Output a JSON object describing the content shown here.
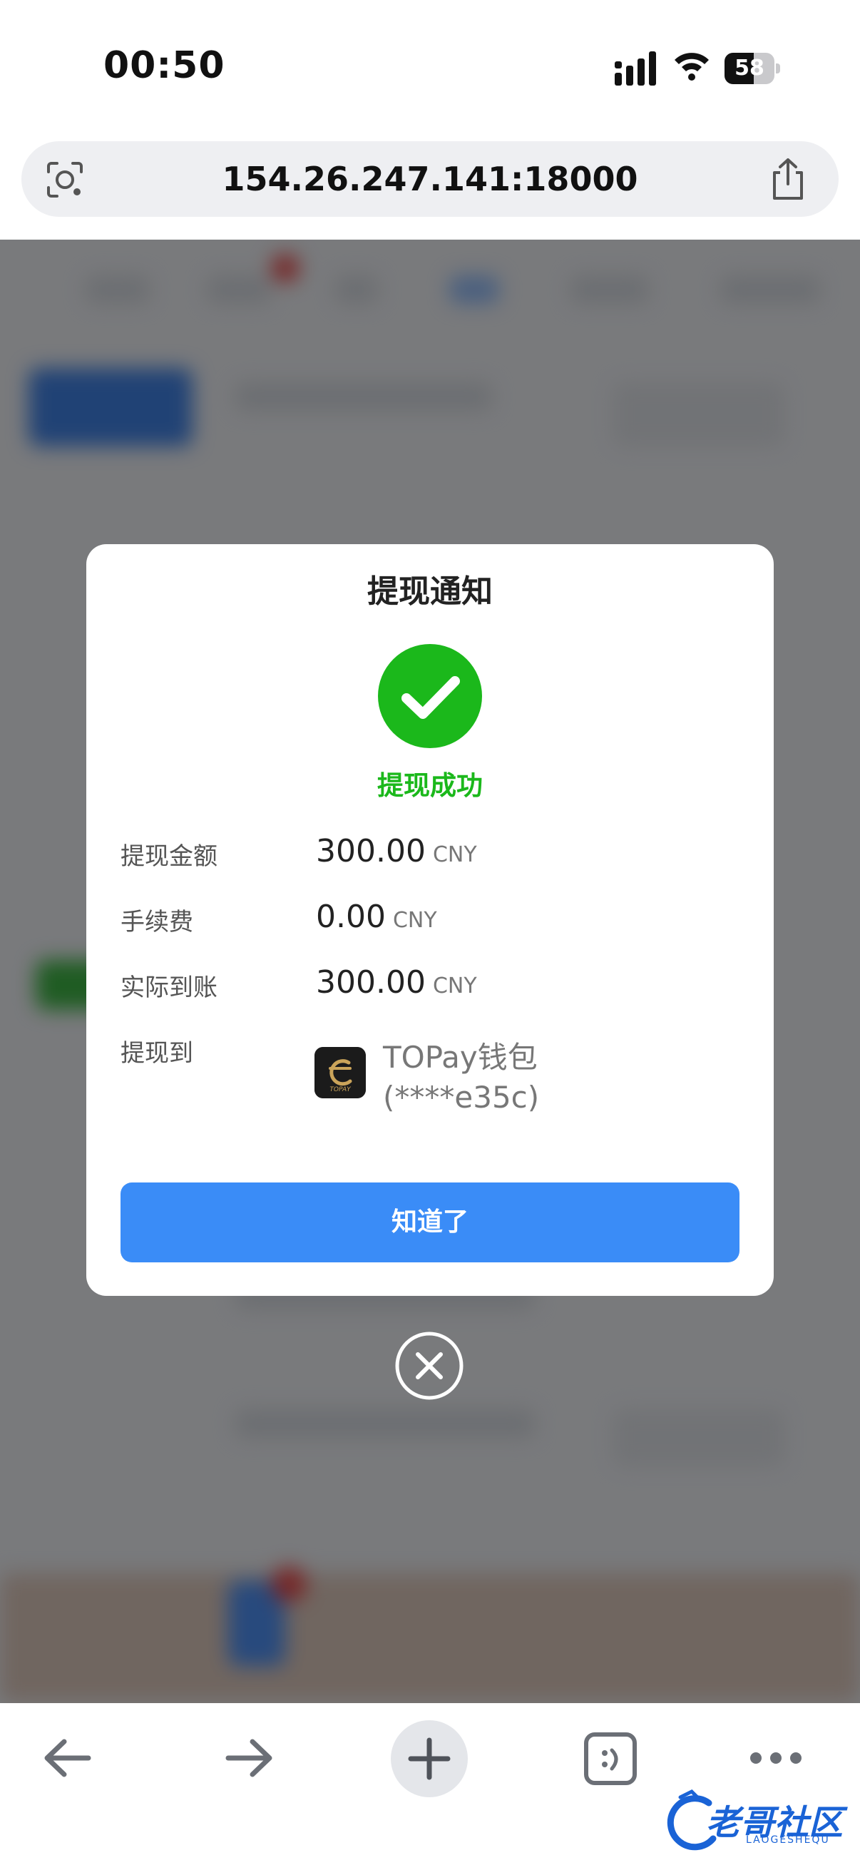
{
  "status_bar": {
    "time": "00:50",
    "battery_percent": "58",
    "battery_level": 0.58
  },
  "address_bar": {
    "url": "154.26.247.141:18000"
  },
  "modal": {
    "title": "提现通知",
    "status_text": "提现成功",
    "rows": [
      {
        "label": "提现金额",
        "value": "300.00",
        "unit": "CNY"
      },
      {
        "label": "手续费",
        "value": "0.00",
        "unit": "CNY"
      },
      {
        "label": "实际到账",
        "value": "300.00",
        "unit": "CNY"
      },
      {
        "label": "提现到",
        "wallet_name": "TOPay钱包",
        "wallet_account": "(****e35c)"
      }
    ],
    "confirm_label": "知道了"
  },
  "colors": {
    "success_green": "#1bb81b",
    "primary_blue": "#3a8cf7"
  },
  "toolbar": {
    "icons": [
      "back-arrow-icon",
      "forward-arrow-icon",
      "plus-icon",
      "tabs-icon",
      "more-icon"
    ]
  },
  "watermark": {
    "text": "老哥社区",
    "sub": "LAOGESHEQU"
  }
}
